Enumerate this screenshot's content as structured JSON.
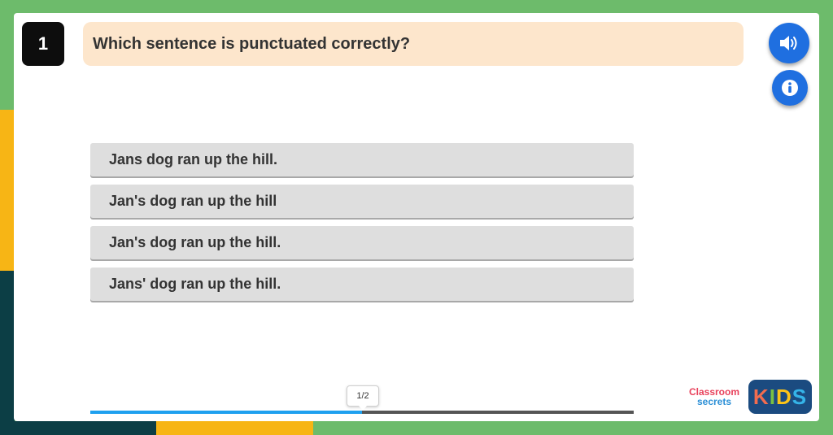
{
  "question": {
    "number": "1",
    "text": "Which sentence is punctuated correctly?"
  },
  "controls": {
    "audio_icon": "speaker-icon",
    "info_icon": "info-icon"
  },
  "answers": [
    {
      "label": "Jans dog ran up the hill."
    },
    {
      "label": "Jan's dog ran up the hill"
    },
    {
      "label": "Jan's dog ran up the hill."
    },
    {
      "label": "Jans' dog ran up the hill."
    }
  ],
  "progress": {
    "label": "1/2",
    "fraction": 0.5
  },
  "logo": {
    "line1": "Classroom",
    "line2": "secrets",
    "kids": [
      "K",
      "I",
      "D",
      "S"
    ]
  },
  "colors": {
    "accent_blue": "#1f6fe0",
    "question_bg": "#fde6cc",
    "answer_bg": "#dedede",
    "progress_fill": "#1ea0ef",
    "frame_green": "#6dbb6b",
    "frame_yellow": "#f7b515",
    "frame_dark": "#0c3e45"
  }
}
